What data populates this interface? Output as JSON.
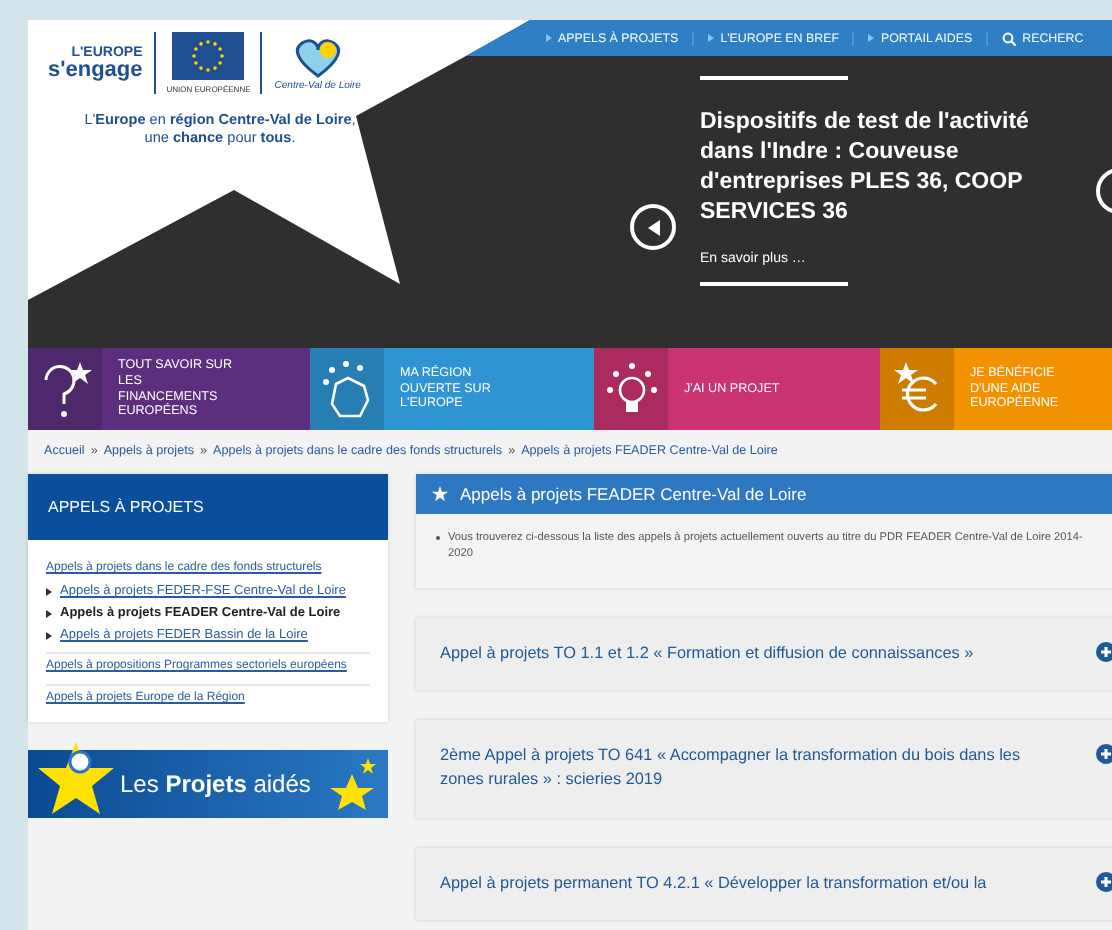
{
  "logo": {
    "badge_top": "L'EUROPE",
    "badge_main": "s'engage",
    "eu_label": "UNION EUROPÉENNE",
    "region_label": "Centre-Val de Loire"
  },
  "tagline": [
    "L'**Europe** en **région Centre-Val de Loire**,",
    "une **chance** pour **tous**."
  ],
  "nav": [
    {
      "label": "APPELS À PROJETS",
      "kind": "link"
    },
    {
      "label": "L'EUROPE EN BREF",
      "kind": "link"
    },
    {
      "label": "PORTAIL AIDES",
      "kind": "link"
    },
    {
      "label": "RECHERC",
      "kind": "search"
    }
  ],
  "hero": {
    "title": "Dispositifs de test de l'activité dans l'Indre : Couveuse d'entreprises PLES 36, COOP SERVICES 36",
    "link": "En savoir plus …"
  },
  "tiles": [
    {
      "label": "TOUT SAVOIR SUR LES FINANCEMENTS EUROPÉENS",
      "kind": "question",
      "color": "#5b2f7d"
    },
    {
      "label": "MA RÉGION OUVERTE SUR L'EUROPE",
      "kind": "map",
      "color": "#2e94d2"
    },
    {
      "label": "J'AI UN PROJET",
      "kind": "bulb",
      "color": "#c9336f"
    },
    {
      "label": "JE BÉNÉFICIE D'UNE AIDE EUROPÉENNE",
      "kind": "euro",
      "color": "#f39200"
    }
  ],
  "breadcrumb": [
    {
      "label": "Accueil"
    },
    {
      "separator": "»",
      "label": "Appels à projets"
    },
    {
      "separator": "»",
      "label": "Appels à projets dans le cadre des fonds structurels"
    },
    {
      "separator": "»",
      "label": "Appels à projets FEADER Centre-Val de Loire"
    }
  ],
  "sidebar": {
    "title": "APPELS À PROJETS",
    "links": [
      {
        "label": "Appels à projets dans le cadre des fonds structurels",
        "children": [
          {
            "label": "Appels à projets FEDER-FSE Centre-Val de Loire",
            "selected": false
          },
          {
            "label": "Appels à projets FEADER Centre-Val de Loire",
            "selected": true
          },
          {
            "label": "Appels à projets FEDER Bassin de la Loire",
            "selected": false
          }
        ]
      },
      {
        "label": "Appels à propositions Programmes sectoriels européens"
      },
      {
        "label": "Appels à projets Europe de la Région"
      }
    ]
  },
  "banner": "Les **Projets** aidés",
  "panel": {
    "title": "Appels à projets FEADER Centre-Val de Loire",
    "text": "Vous trouverez ci-dessous la liste des appels à projets actuellement ouverts au titre du PDR FEADER Centre-Val de Loire 2014-2020"
  },
  "accordion": [
    {
      "title": "Appel à projets TO 1.1 et 1.2 « Formation et diffusion de connaissances »",
      "expanded": false
    },
    {
      "title": "2ème Appel à projets TO 641 « Accompagner la transformation du bois dans les zones rurales » : scieries 2019",
      "expanded": false
    },
    {
      "title": "Appel à projets permanent TO 4.2.1 « Développer la transformation et/ou la",
      "expanded": false
    }
  ]
}
